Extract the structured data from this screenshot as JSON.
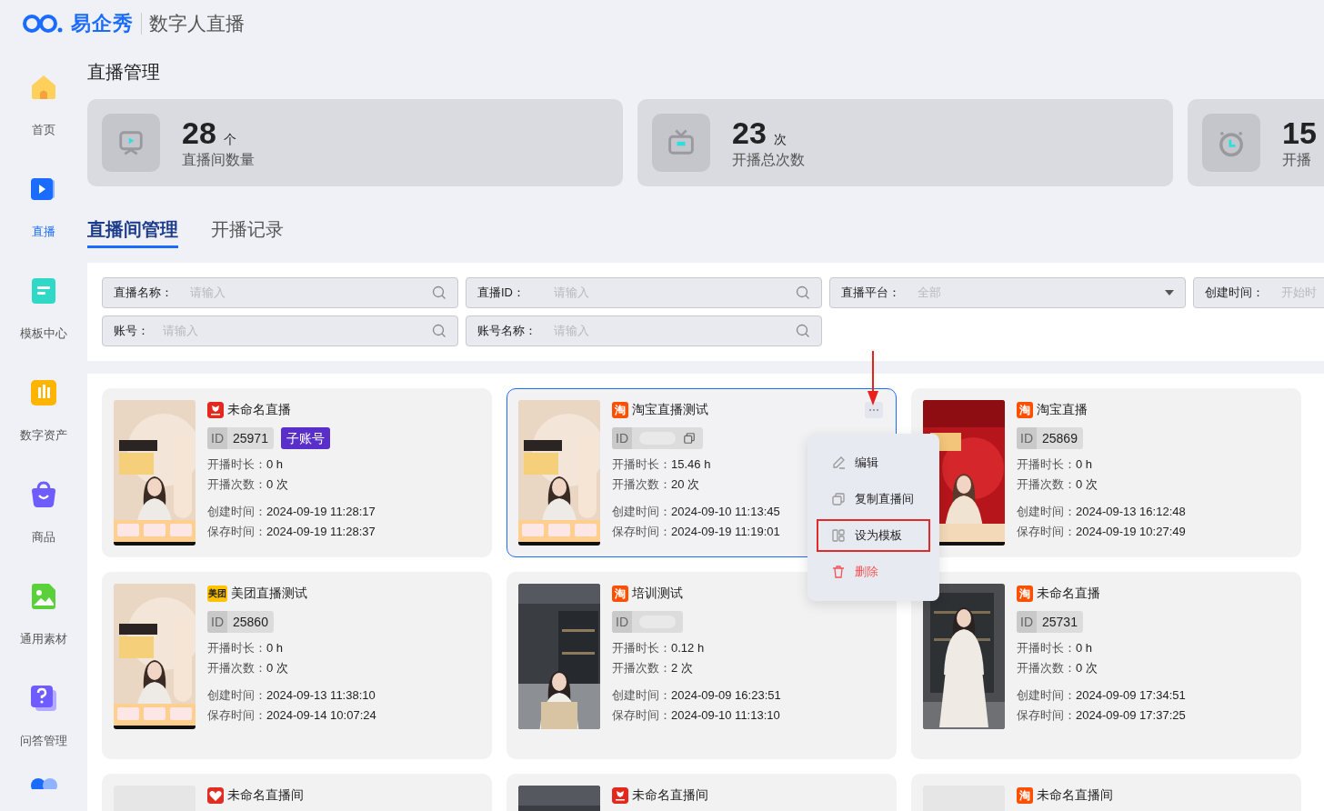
{
  "header": {
    "brand": "易企秀",
    "product": "数字人直播"
  },
  "sidebar": {
    "items": [
      {
        "label": "首页",
        "selected": false
      },
      {
        "label": "直播",
        "selected": true
      },
      {
        "label": "模板中心",
        "selected": false
      },
      {
        "label": "数字资产",
        "selected": false
      },
      {
        "label": "商品",
        "selected": false
      },
      {
        "label": "通用素材",
        "selected": false
      },
      {
        "label": "问答管理",
        "selected": false
      }
    ]
  },
  "page_title": "直播管理",
  "stats": [
    {
      "value": "28",
      "unit": "个",
      "label": "直播间数量"
    },
    {
      "value": "23",
      "unit": "次",
      "label": "开播总次数"
    },
    {
      "value": "15",
      "label": "开播"
    }
  ],
  "tabs": [
    {
      "label": "直播间管理",
      "selected": true
    },
    {
      "label": "开播记录",
      "selected": false
    }
  ],
  "filters": [
    {
      "kind": "search",
      "label": "直播名称：",
      "placeholder": "请输入"
    },
    {
      "kind": "search",
      "label": "直播ID：",
      "placeholder": "请输入"
    },
    {
      "kind": "select",
      "label": "直播平台：",
      "placeholder": "全部"
    },
    {
      "kind": "date",
      "label": "创建时间：",
      "placeholder": "开始时"
    },
    {
      "kind": "search",
      "label": "账号：",
      "placeholder": "请输入"
    },
    {
      "kind": "search",
      "label": "账号名称：",
      "placeholder": "请输入"
    }
  ],
  "rooms": [
    {
      "platform": {
        "kind": "jd"
      },
      "name": "未命名直播",
      "id_label": "ID",
      "id": "25971",
      "tag": "子账号",
      "selected": false,
      "fields": [
        {
          "label": "开播时长：",
          "value": "0 h"
        },
        {
          "label": "开播次数：",
          "value": "0 次"
        },
        {
          "label": "创建时间：",
          "value": "2024-09-19 11:28:17"
        },
        {
          "label": "保存时间：",
          "value": "2024-09-19 11:28:37"
        }
      ]
    },
    {
      "platform": {
        "kind": "taobao",
        "mark": "淘"
      },
      "name": "淘宝直播测试",
      "id_label": "ID",
      "id_masked": true,
      "copyable": true,
      "selected": true,
      "fields": [
        {
          "label": "开播时长：",
          "value": "15.46 h"
        },
        {
          "label": "开播次数：",
          "value": "20 次"
        },
        {
          "label": "创建时间：",
          "value": "2024-09-10 11:13:45"
        },
        {
          "label": "保存时间：",
          "value": "2024-09-19 11:19:01"
        }
      ]
    },
    {
      "platform": {
        "kind": "taobao",
        "mark": "淘"
      },
      "name": "淘宝直播",
      "id_label": "ID",
      "id": "25869",
      "selected": false,
      "fields": [
        {
          "label": "开播时长：",
          "value": "0 h"
        },
        {
          "label": "开播次数：",
          "value": "0 次"
        },
        {
          "label": "创建时间：",
          "value": "2024-09-13 16:12:48"
        },
        {
          "label": "保存时间：",
          "value": "2024-09-19 10:27:49"
        }
      ]
    },
    {
      "platform": {
        "kind": "meituan",
        "mark": "美团"
      },
      "name": "美团直播测试",
      "id_label": "ID",
      "id": "25860",
      "selected": false,
      "fields": [
        {
          "label": "开播时长：",
          "value": "0 h"
        },
        {
          "label": "开播次数：",
          "value": "0 次"
        },
        {
          "label": "创建时间：",
          "value": "2024-09-13 11:38:10"
        },
        {
          "label": "保存时间：",
          "value": "2024-09-14 10:07:24"
        }
      ]
    },
    {
      "platform": {
        "kind": "taobao",
        "mark": "淘"
      },
      "name": "培训测试",
      "id_label": "ID",
      "id_masked": true,
      "selected": false,
      "fields": [
        {
          "label": "开播时长：",
          "value": "0.12 h"
        },
        {
          "label": "开播次数：",
          "value": "2 次"
        },
        {
          "label": "创建时间：",
          "value": "2024-09-09 16:23:51"
        },
        {
          "label": "保存时间：",
          "value": "2024-09-10 11:13:10"
        }
      ]
    },
    {
      "platform": {
        "kind": "taobao",
        "mark": "淘"
      },
      "name": "未命名直播",
      "id_label": "ID",
      "id": "25731",
      "selected": false,
      "fields": [
        {
          "label": "开播时长：",
          "value": "0 h"
        },
        {
          "label": "开播次数：",
          "value": "0 次"
        },
        {
          "label": "创建时间：",
          "value": "2024-09-09 17:34:51"
        },
        {
          "label": "保存时间：",
          "value": "2024-09-09 17:37:25"
        }
      ]
    },
    {
      "platform": {
        "kind": "pinduoduo"
      },
      "name": "未命名直播间",
      "selected": false
    },
    {
      "platform": {
        "kind": "jd"
      },
      "name": "未命名直播间",
      "selected": false
    },
    {
      "platform": {
        "kind": "taobao",
        "mark": "淘"
      },
      "name": "未命名直播间",
      "selected": false
    }
  ],
  "context_menu": {
    "items": [
      {
        "kind": "edit",
        "label": "编辑",
        "highlighted": false
      },
      {
        "kind": "copy",
        "label": "复制直播间",
        "highlighted": false
      },
      {
        "kind": "template",
        "label": "设为模板",
        "highlighted": true
      },
      {
        "kind": "delete",
        "label": "删除",
        "highlighted": false
      }
    ]
  }
}
